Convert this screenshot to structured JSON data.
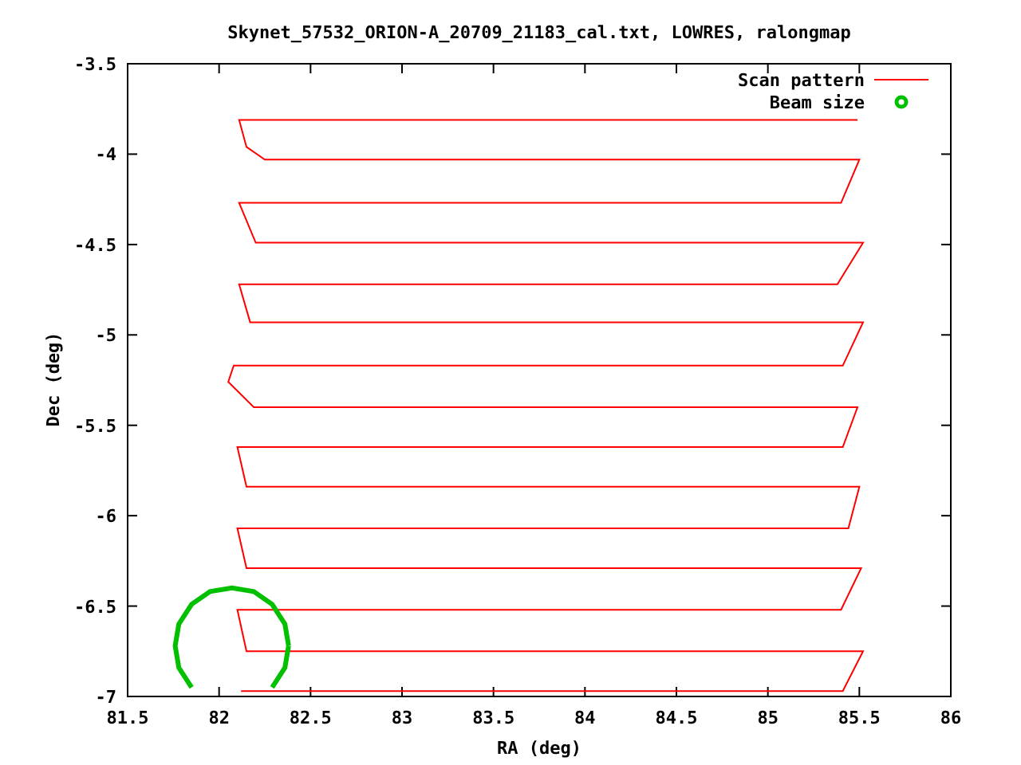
{
  "chart_data": {
    "type": "line",
    "title": "Skynet_57532_ORION-A_20709_21183_cal.txt, LOWRES, ralongmap",
    "xlabel": "RA (deg)",
    "ylabel": "Dec (deg)",
    "xlim": [
      81.5,
      86
    ],
    "ylim": [
      -7,
      -3.5
    ],
    "xticks": [
      81.5,
      82,
      82.5,
      83,
      83.5,
      84,
      84.5,
      85,
      85.5,
      86
    ],
    "yticks": [
      -7,
      -6.5,
      -6,
      -5.5,
      -5,
      -4.5,
      -4,
      -3.5
    ],
    "series": [
      {
        "name": "Scan pattern",
        "color": "#ff0000",
        "x": [
          85.49,
          82.11,
          82.15,
          82.25,
          85.5,
          85.4,
          82.11,
          82.2,
          85.52,
          85.38,
          82.11,
          82.17,
          85.52,
          85.41,
          82.08,
          82.05,
          82.19,
          85.49,
          85.41,
          82.1,
          82.15,
          85.5,
          85.44,
          82.1,
          82.15,
          85.51,
          85.4,
          82.1,
          82.15,
          85.52,
          85.41,
          82.12
        ],
        "values": [
          -3.81,
          -3.81,
          -3.96,
          -4.03,
          -4.03,
          -4.27,
          -4.27,
          -4.49,
          -4.49,
          -4.72,
          -4.72,
          -4.93,
          -4.93,
          -5.17,
          -5.17,
          -5.26,
          -5.4,
          -5.4,
          -5.62,
          -5.62,
          -5.84,
          -5.84,
          -6.07,
          -6.07,
          -6.29,
          -6.29,
          -6.52,
          -6.52,
          -6.75,
          -6.75,
          -6.97,
          -6.97
        ]
      },
      {
        "name": "Beam size",
        "color": "#00c000",
        "x": [
          82.38,
          82.36,
          82.29,
          82.19,
          82.07,
          81.95,
          81.85,
          81.78,
          81.76,
          81.78,
          81.85,
          81.95,
          82.07,
          82.19,
          82.29,
          82.36,
          82.38
        ],
        "values": [
          -6.72,
          -6.6,
          -6.49,
          -6.42,
          -6.4,
          -6.42,
          -6.49,
          -6.6,
          -6.72,
          -6.84,
          -6.95,
          null,
          null,
          null,
          -6.95,
          -6.84,
          -6.72
        ]
      }
    ]
  }
}
